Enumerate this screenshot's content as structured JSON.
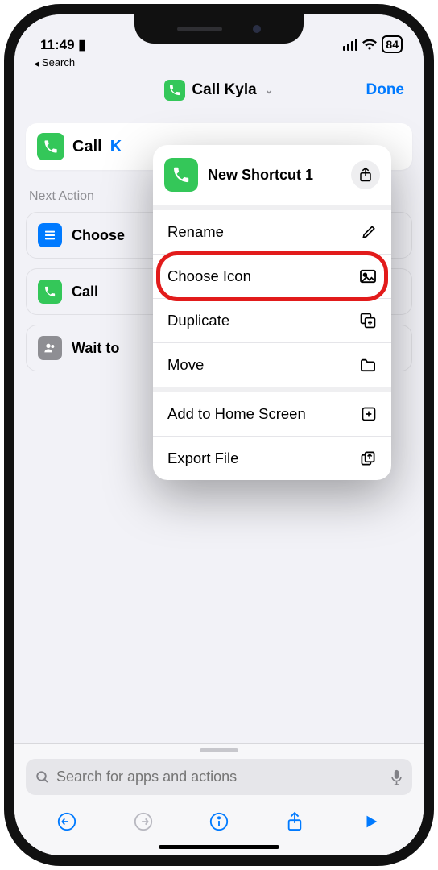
{
  "status": {
    "time": "11:49",
    "battery": "84"
  },
  "back_link": "Search",
  "header": {
    "title": "Call Kyla",
    "done": "Done"
  },
  "action": {
    "verb": "Call",
    "arg": "K"
  },
  "section_label": "Next Action",
  "suggestions": [
    {
      "icon": "choose",
      "label": "Choose"
    },
    {
      "icon": "phone",
      "label": "Call"
    },
    {
      "icon": "wait",
      "label": "Wait to"
    }
  ],
  "popup": {
    "title": "New Shortcut 1",
    "items": [
      {
        "label": "Rename",
        "icon": "pencil"
      },
      {
        "label": "Choose Icon",
        "icon": "image",
        "highlighted": true
      },
      {
        "label": "Duplicate",
        "icon": "duplicate"
      },
      {
        "label": "Move",
        "icon": "folder",
        "group_end": true
      },
      {
        "label": "Add to Home Screen",
        "icon": "plus-square"
      },
      {
        "label": "Export File",
        "icon": "export"
      }
    ]
  },
  "search": {
    "placeholder": "Search for apps and actions"
  }
}
